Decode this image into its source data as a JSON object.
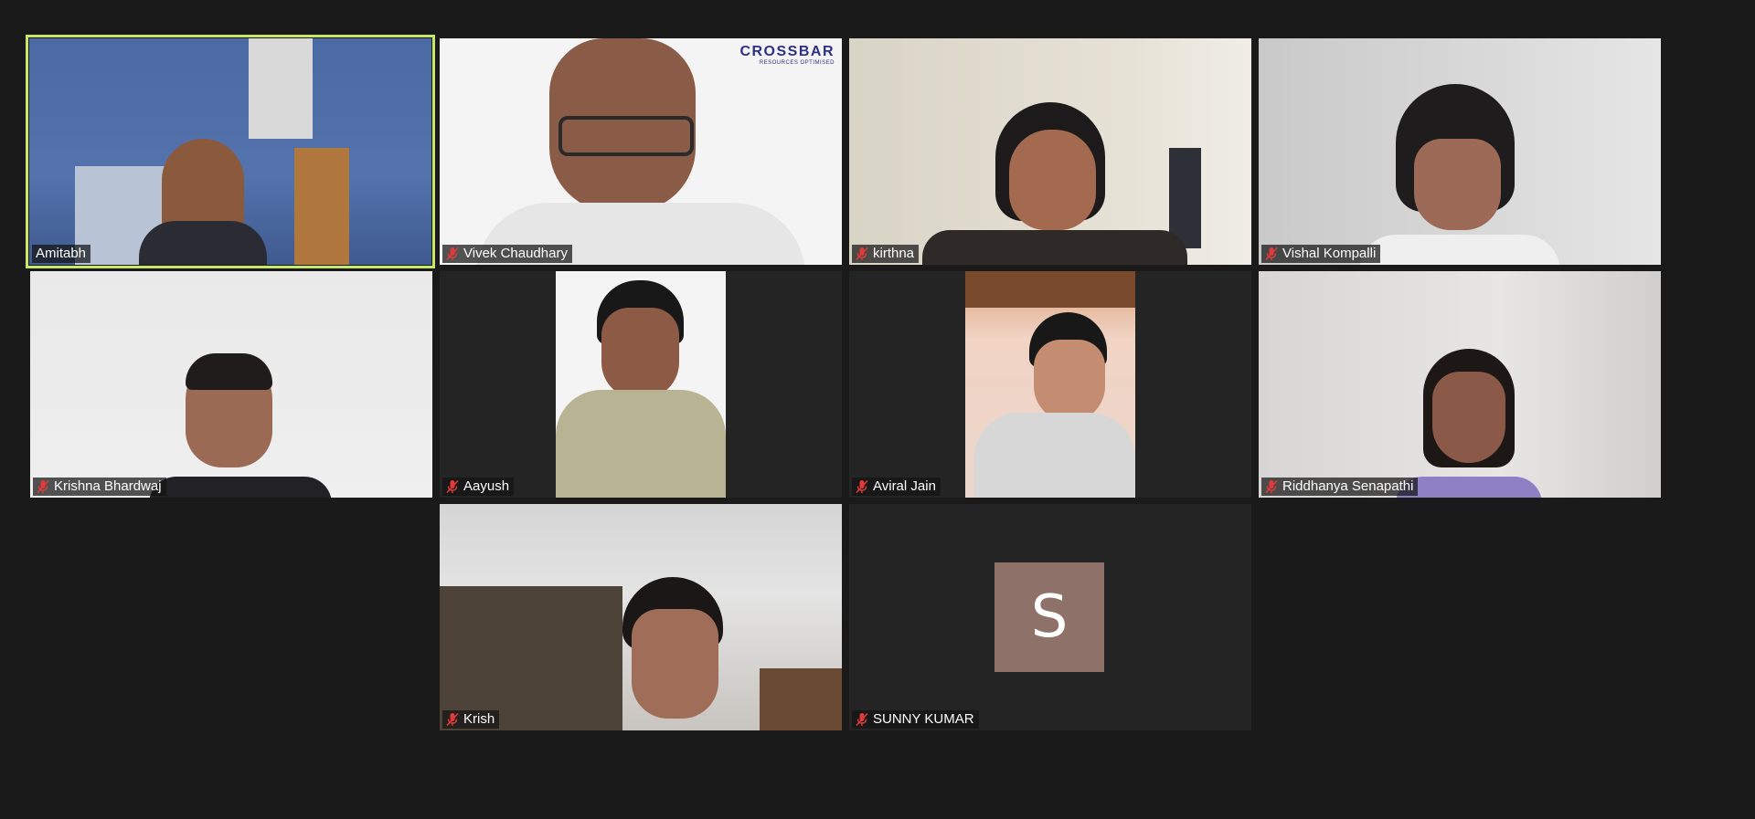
{
  "meeting": {
    "participants": [
      {
        "name": "Amitabh",
        "muted": false,
        "active_speaker": true
      },
      {
        "name": "Vivek Chaudhary",
        "muted": true,
        "active_speaker": false
      },
      {
        "name": "kirthna",
        "muted": true,
        "active_speaker": false
      },
      {
        "name": "Vishal Kompalli",
        "muted": true,
        "active_speaker": false
      },
      {
        "name": "Krishna Bhardwaj",
        "muted": true,
        "active_speaker": false
      },
      {
        "name": "Aayush",
        "muted": true,
        "active_speaker": false
      },
      {
        "name": "Aviral Jain",
        "muted": true,
        "active_speaker": false
      },
      {
        "name": "Riddhanya Senapathi",
        "muted": true,
        "active_speaker": false
      },
      {
        "name": "Krish",
        "muted": true,
        "active_speaker": false
      },
      {
        "name": "SUNNY KUMAR",
        "muted": true,
        "active_speaker": false,
        "avatar_initial": "S"
      }
    ],
    "logo": {
      "brand": "CROSSBAR",
      "tagline": "RESOURCES OPTIMISED"
    },
    "colors": {
      "active_border": "#c7e66a",
      "muted_icon": "#e03a3a",
      "avatar_bg": "#8e7168",
      "background": "#1a1a1a"
    },
    "icons": [
      "mic-muted-icon"
    ]
  }
}
